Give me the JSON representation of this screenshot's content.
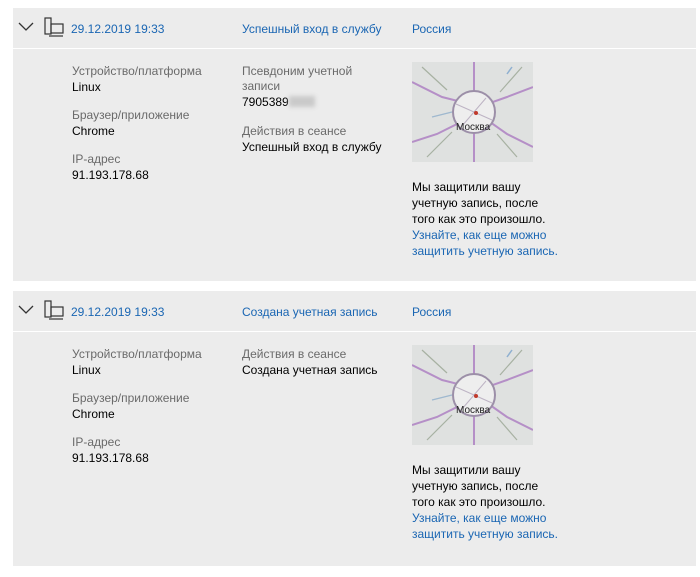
{
  "entries": [
    {
      "date": "29.12.2019 19:33",
      "event": "Успешный вход в службу",
      "country": "Россия",
      "device_label": "Устройство/платформа",
      "device_value": "Linux",
      "browser_label": "Браузер/приложение",
      "browser_value": "Chrome",
      "ip_label": "IP-адрес",
      "ip_value": "91.193.178.68",
      "alias_label_1": "Псевдоним учетной",
      "alias_label_2": "записи",
      "alias_value": "7905389",
      "action_label": "Действия в сеансе",
      "action_value": "Успешный вход в службу",
      "map_city": "Москва",
      "note_1": "Мы защитили вашу",
      "note_2": "учетную запись, после",
      "note_3": "того как это произошло.",
      "link_1": "Узнайте, как еще можно",
      "link_2": "защитить учетную запись."
    },
    {
      "date": "29.12.2019 19:33",
      "event": "Создана учетная запись",
      "country": "Россия",
      "device_label": "Устройство/платформа",
      "device_value": "Linux",
      "browser_label": "Браузер/приложение",
      "browser_value": "Chrome",
      "ip_label": "IP-адрес",
      "ip_value": "91.193.178.68",
      "action_label": "Действия в сеансе",
      "action_value": "Создана учетная запись",
      "map_city": "Москва",
      "note_1": "Мы защитили вашу",
      "note_2": "учетную запись, после",
      "note_3": "того как это произошло.",
      "link_1": "Узнайте, как еще можно",
      "link_2": "защитить учетную запись."
    }
  ],
  "colors": {
    "link": "#1a66b3",
    "label": "#6a6a6a",
    "panel": "#ececec"
  },
  "icons": {
    "expand": "chevron-down-icon",
    "device": "computer-device-icon",
    "map_pin": "map-pin-icon"
  }
}
